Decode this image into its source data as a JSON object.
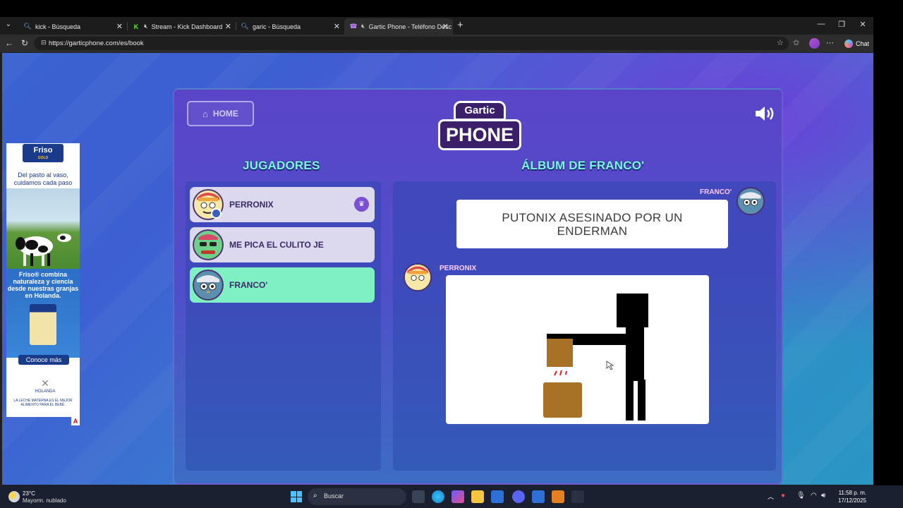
{
  "browser": {
    "tabs": [
      {
        "title": "kick - Búsqueda",
        "icon": "search-icon"
      },
      {
        "title": "Stream - Kick Dashboard",
        "icon": "kick-icon",
        "muted": true
      },
      {
        "title": "garic - Búsqueda",
        "icon": "search-icon"
      },
      {
        "title": "Gartic Phone - Teléfono Desc",
        "icon": "gartic-icon",
        "muted": true,
        "active": true
      }
    ],
    "url": "https://garticphone.com/es/book",
    "chat_label": "Chat"
  },
  "game": {
    "home_label": "HOME",
    "logo_top": "Gartic",
    "logo_bottom": "PHONE",
    "players_title": "JUGADORES",
    "album_title": "ÁLBUM DE FRANCO'",
    "players": [
      {
        "name": "PERRONIX",
        "host": true,
        "active": false
      },
      {
        "name": "ME PICA EL CULITO JE",
        "host": false,
        "active": false
      },
      {
        "name": "FRANCO'",
        "host": false,
        "active": true
      }
    ],
    "album": {
      "entry1_author": "FRANCO'",
      "entry1_text": "PUTONIX ASESINADO POR UN ENDERMAN",
      "entry2_author": "PERRONIX"
    },
    "colors": {
      "accent_title": "#7df5e6",
      "active_player": "#7ff0c4",
      "crown": "#7a4fd0"
    }
  },
  "ad": {
    "brand": "Friso",
    "brand_sub": "GOLD",
    "tagline": "Del pasto al vaso, cuidamos cada paso",
    "copy": "Friso® combina naturaleza y ciencia desde nuestras granjas en Holanda.",
    "cta": "Conoce más",
    "origin": "HOLANDA",
    "disclaimer": "LA LECHE MATERNA ES EL MEJOR ALIMENTO PARA EL BEBÉ."
  },
  "taskbar": {
    "temperature": "23°C",
    "weather": "Mayorm. nublado",
    "search_label": "Buscar",
    "time": "11:58 p. m.",
    "date": "17/12/2025"
  }
}
